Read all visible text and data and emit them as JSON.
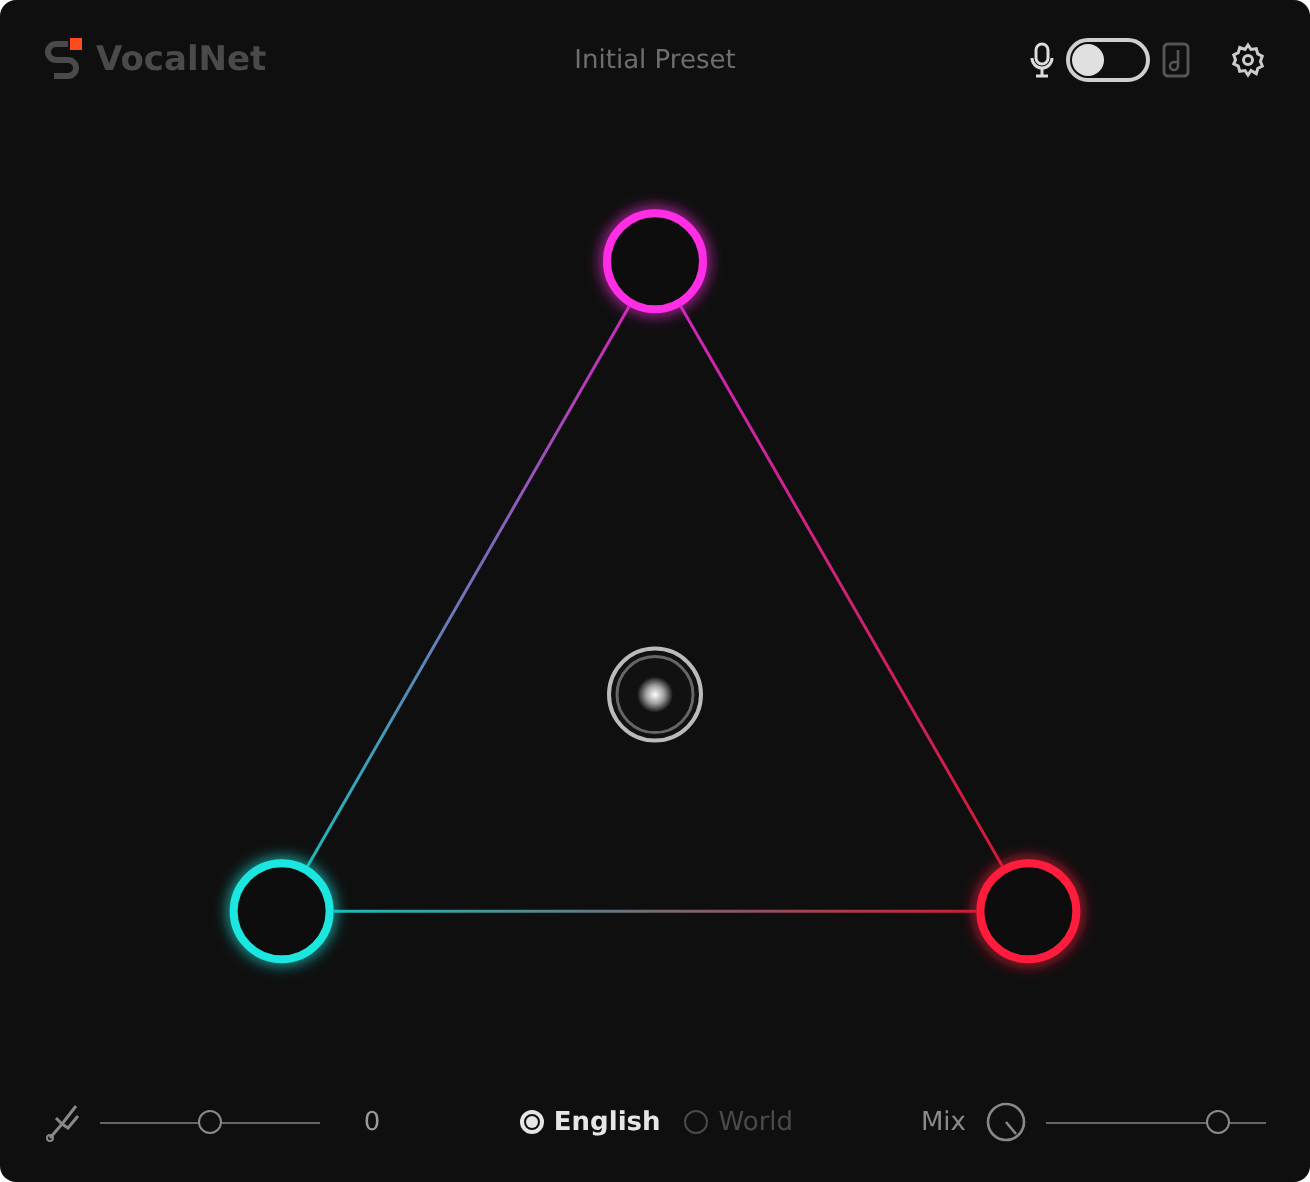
{
  "header": {
    "brand": "VocalNet",
    "preset": "Initial Preset",
    "mode_toggle": {
      "on": false
    }
  },
  "canvas": {
    "nodes": [
      {
        "color": "#ff2ee6"
      },
      {
        "color": "#1ee6e0"
      },
      {
        "color": "#ff1f3d"
      }
    ]
  },
  "footer": {
    "pitch": {
      "level": 0.5,
      "reading": "0"
    },
    "languages": [
      {
        "label": "English",
        "selected": true
      },
      {
        "label": "World",
        "selected": false
      }
    ],
    "mix": {
      "label": "Mix",
      "level": 0.78
    }
  }
}
